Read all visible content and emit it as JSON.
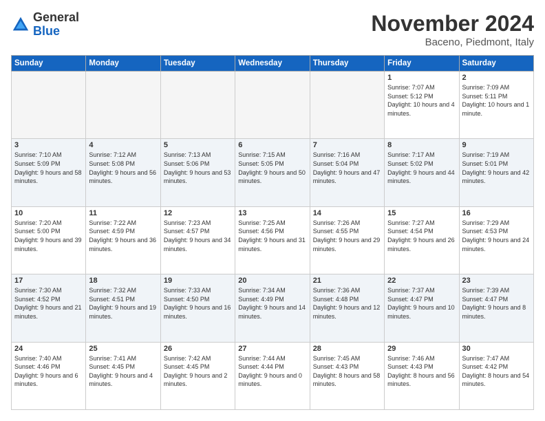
{
  "logo": {
    "general": "General",
    "blue": "Blue"
  },
  "header": {
    "month": "November 2024",
    "location": "Baceno, Piedmont, Italy"
  },
  "days_of_week": [
    "Sunday",
    "Monday",
    "Tuesday",
    "Wednesday",
    "Thursday",
    "Friday",
    "Saturday"
  ],
  "weeks": [
    [
      {
        "day": "",
        "empty": true
      },
      {
        "day": "",
        "empty": true
      },
      {
        "day": "",
        "empty": true
      },
      {
        "day": "",
        "empty": true
      },
      {
        "day": "",
        "empty": true
      },
      {
        "day": "1",
        "sunrise": "Sunrise: 7:07 AM",
        "sunset": "Sunset: 5:12 PM",
        "daylight": "Daylight: 10 hours and 4 minutes."
      },
      {
        "day": "2",
        "sunrise": "Sunrise: 7:09 AM",
        "sunset": "Sunset: 5:11 PM",
        "daylight": "Daylight: 10 hours and 1 minute."
      }
    ],
    [
      {
        "day": "3",
        "sunrise": "Sunrise: 7:10 AM",
        "sunset": "Sunset: 5:09 PM",
        "daylight": "Daylight: 9 hours and 58 minutes."
      },
      {
        "day": "4",
        "sunrise": "Sunrise: 7:12 AM",
        "sunset": "Sunset: 5:08 PM",
        "daylight": "Daylight: 9 hours and 56 minutes."
      },
      {
        "day": "5",
        "sunrise": "Sunrise: 7:13 AM",
        "sunset": "Sunset: 5:06 PM",
        "daylight": "Daylight: 9 hours and 53 minutes."
      },
      {
        "day": "6",
        "sunrise": "Sunrise: 7:15 AM",
        "sunset": "Sunset: 5:05 PM",
        "daylight": "Daylight: 9 hours and 50 minutes."
      },
      {
        "day": "7",
        "sunrise": "Sunrise: 7:16 AM",
        "sunset": "Sunset: 5:04 PM",
        "daylight": "Daylight: 9 hours and 47 minutes."
      },
      {
        "day": "8",
        "sunrise": "Sunrise: 7:17 AM",
        "sunset": "Sunset: 5:02 PM",
        "daylight": "Daylight: 9 hours and 44 minutes."
      },
      {
        "day": "9",
        "sunrise": "Sunrise: 7:19 AM",
        "sunset": "Sunset: 5:01 PM",
        "daylight": "Daylight: 9 hours and 42 minutes."
      }
    ],
    [
      {
        "day": "10",
        "sunrise": "Sunrise: 7:20 AM",
        "sunset": "Sunset: 5:00 PM",
        "daylight": "Daylight: 9 hours and 39 minutes."
      },
      {
        "day": "11",
        "sunrise": "Sunrise: 7:22 AM",
        "sunset": "Sunset: 4:59 PM",
        "daylight": "Daylight: 9 hours and 36 minutes."
      },
      {
        "day": "12",
        "sunrise": "Sunrise: 7:23 AM",
        "sunset": "Sunset: 4:57 PM",
        "daylight": "Daylight: 9 hours and 34 minutes."
      },
      {
        "day": "13",
        "sunrise": "Sunrise: 7:25 AM",
        "sunset": "Sunset: 4:56 PM",
        "daylight": "Daylight: 9 hours and 31 minutes."
      },
      {
        "day": "14",
        "sunrise": "Sunrise: 7:26 AM",
        "sunset": "Sunset: 4:55 PM",
        "daylight": "Daylight: 9 hours and 29 minutes."
      },
      {
        "day": "15",
        "sunrise": "Sunrise: 7:27 AM",
        "sunset": "Sunset: 4:54 PM",
        "daylight": "Daylight: 9 hours and 26 minutes."
      },
      {
        "day": "16",
        "sunrise": "Sunrise: 7:29 AM",
        "sunset": "Sunset: 4:53 PM",
        "daylight": "Daylight: 9 hours and 24 minutes."
      }
    ],
    [
      {
        "day": "17",
        "sunrise": "Sunrise: 7:30 AM",
        "sunset": "Sunset: 4:52 PM",
        "daylight": "Daylight: 9 hours and 21 minutes."
      },
      {
        "day": "18",
        "sunrise": "Sunrise: 7:32 AM",
        "sunset": "Sunset: 4:51 PM",
        "daylight": "Daylight: 9 hours and 19 minutes."
      },
      {
        "day": "19",
        "sunrise": "Sunrise: 7:33 AM",
        "sunset": "Sunset: 4:50 PM",
        "daylight": "Daylight: 9 hours and 16 minutes."
      },
      {
        "day": "20",
        "sunrise": "Sunrise: 7:34 AM",
        "sunset": "Sunset: 4:49 PM",
        "daylight": "Daylight: 9 hours and 14 minutes."
      },
      {
        "day": "21",
        "sunrise": "Sunrise: 7:36 AM",
        "sunset": "Sunset: 4:48 PM",
        "daylight": "Daylight: 9 hours and 12 minutes."
      },
      {
        "day": "22",
        "sunrise": "Sunrise: 7:37 AM",
        "sunset": "Sunset: 4:47 PM",
        "daylight": "Daylight: 9 hours and 10 minutes."
      },
      {
        "day": "23",
        "sunrise": "Sunrise: 7:39 AM",
        "sunset": "Sunset: 4:47 PM",
        "daylight": "Daylight: 9 hours and 8 minutes."
      }
    ],
    [
      {
        "day": "24",
        "sunrise": "Sunrise: 7:40 AM",
        "sunset": "Sunset: 4:46 PM",
        "daylight": "Daylight: 9 hours and 6 minutes."
      },
      {
        "day": "25",
        "sunrise": "Sunrise: 7:41 AM",
        "sunset": "Sunset: 4:45 PM",
        "daylight": "Daylight: 9 hours and 4 minutes."
      },
      {
        "day": "26",
        "sunrise": "Sunrise: 7:42 AM",
        "sunset": "Sunset: 4:45 PM",
        "daylight": "Daylight: 9 hours and 2 minutes."
      },
      {
        "day": "27",
        "sunrise": "Sunrise: 7:44 AM",
        "sunset": "Sunset: 4:44 PM",
        "daylight": "Daylight: 9 hours and 0 minutes."
      },
      {
        "day": "28",
        "sunrise": "Sunrise: 7:45 AM",
        "sunset": "Sunset: 4:43 PM",
        "daylight": "Daylight: 8 hours and 58 minutes."
      },
      {
        "day": "29",
        "sunrise": "Sunrise: 7:46 AM",
        "sunset": "Sunset: 4:43 PM",
        "daylight": "Daylight: 8 hours and 56 minutes."
      },
      {
        "day": "30",
        "sunrise": "Sunrise: 7:47 AM",
        "sunset": "Sunset: 4:42 PM",
        "daylight": "Daylight: 8 hours and 54 minutes."
      }
    ]
  ]
}
